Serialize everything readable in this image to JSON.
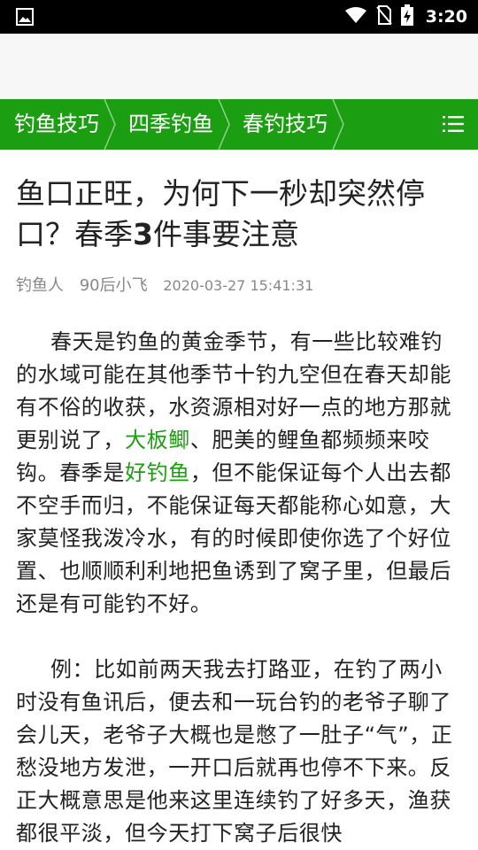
{
  "status": {
    "time": "3:20"
  },
  "breadcrumb": {
    "items": [
      {
        "label": "钓鱼技巧"
      },
      {
        "label": "四季钓鱼"
      },
      {
        "label": "春钓技巧"
      }
    ]
  },
  "article": {
    "title_part1": "鱼口正旺，为何下一秒却突然停口？春季",
    "title_bold": "3",
    "title_part2": "件事要注意",
    "category": "钓鱼人",
    "author": "90后小飞",
    "date": "2020-03-27 15:41:31",
    "p1": {
      "t1": "春天是钓鱼的黄金季节，有一些比较难钓的水域可能在其他季节十钓九空但在春天却能有不俗的收获，水资源相对好一点的地方那就更别说了，",
      "link1": "大板鲫",
      "t2": "、肥美的鲤鱼都频频来咬钩。春季是",
      "link2": "好钓鱼",
      "t3": "，但不能保证每个人出去都不空手而归，不能保证每天都能称心如意，大家莫怪我泼冷水，有的时候即使你选了个好位置、也顺顺利利地把鱼诱到了窝子里，但最后还是有可能钓不好。"
    },
    "p2": "例：比如前两天我去打路亚，在钓了两小时没有鱼讯后，便去和一玩台钓的老爷子聊了会儿天，老爷子大概也是憋了一肚子“气”，正愁没地方发泄，一开口后就再也停不下来。反正大概意思是他来这里连续钓了好多天，渔获都很平淡，但今天打下窝子后很快"
  },
  "colors": {
    "accent": "#1b9e12",
    "status_bar": "#000000"
  }
}
